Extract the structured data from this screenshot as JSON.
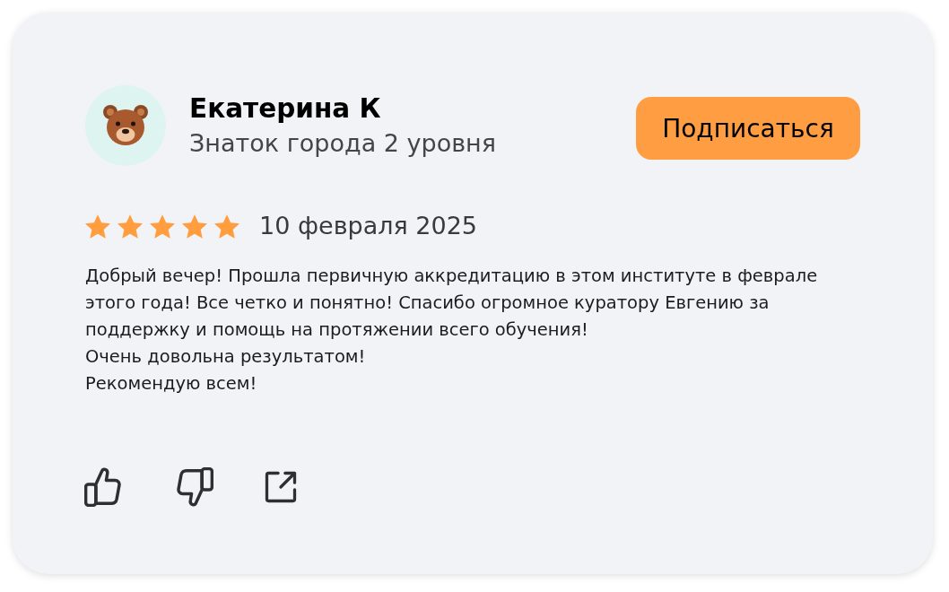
{
  "review": {
    "author": {
      "name": "Екатерина К",
      "status": "Знаток города 2 уровня"
    },
    "subscribe_button": "Подписаться",
    "stars": 5,
    "date": "10 февраля 2025",
    "text": "Добрый вечер! Прошла первичную аккредитацию в этом институте в феврале этого года! Все четко и понятно! Спасибо огромное куратору Евгению за поддержку и помощь на протяжении всего обучения!\nОчень довольна результатом!\nРекомендую всем!"
  }
}
